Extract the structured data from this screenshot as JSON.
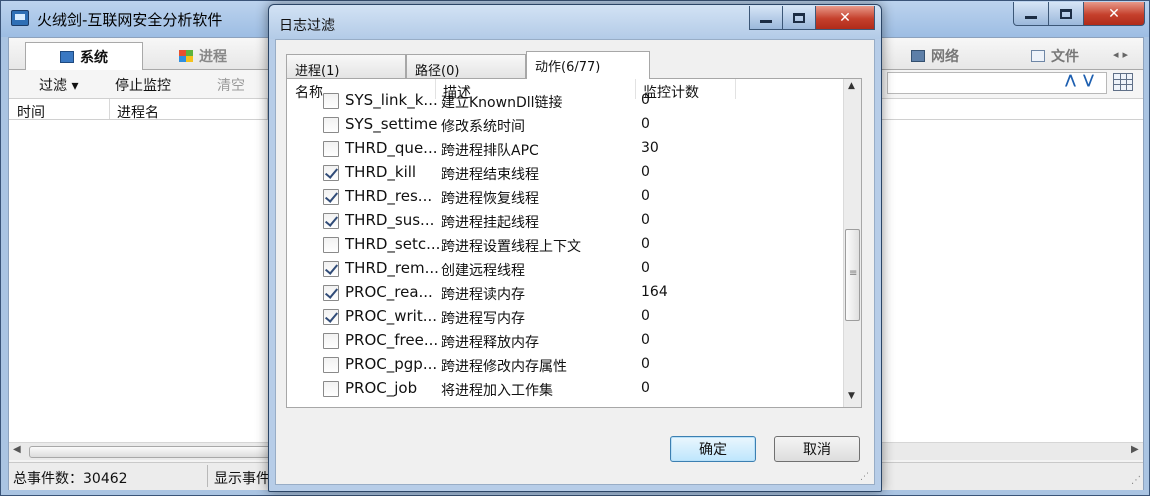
{
  "main_window": {
    "title": "火绒剑-互联网安全分析软件",
    "tabs": [
      {
        "label": "系统"
      },
      {
        "label": "进程"
      },
      {
        "label": "网络"
      },
      {
        "label": "文件"
      }
    ],
    "toolbar": {
      "filter": "过滤 ▾",
      "stop_monitor": "停止监控",
      "clear": "清空"
    },
    "columns": {
      "time": "时间",
      "process_name": "进程名"
    },
    "status": {
      "total_events": "总事件数：30462",
      "shown_events": "显示事件"
    }
  },
  "dialog": {
    "title": "日志过滤",
    "tabs": [
      {
        "label": "进程(1)"
      },
      {
        "label": "路径(0)"
      },
      {
        "label": "动作(6/77)"
      }
    ],
    "columns": {
      "name": "名称",
      "description": "描述",
      "count": "监控计数"
    },
    "rows": [
      {
        "name": "SYS_link_k...",
        "description": "建立KnownDll链接",
        "count": "0",
        "checked": false
      },
      {
        "name": "SYS_settime",
        "description": "修改系统时间",
        "count": "0",
        "checked": false
      },
      {
        "name": "THRD_que...",
        "description": "跨进程排队APC",
        "count": "30",
        "checked": false
      },
      {
        "name": "THRD_kill",
        "description": "跨进程结束线程",
        "count": "0",
        "checked": true
      },
      {
        "name": "THRD_res...",
        "description": "跨进程恢复线程",
        "count": "0",
        "checked": true
      },
      {
        "name": "THRD_sus...",
        "description": "跨进程挂起线程",
        "count": "0",
        "checked": true
      },
      {
        "name": "THRD_setc...",
        "description": "跨进程设置线程上下文",
        "count": "0",
        "checked": false
      },
      {
        "name": "THRD_rem...",
        "description": "创建远程线程",
        "count": "0",
        "checked": true
      },
      {
        "name": "PROC_rea...",
        "description": "跨进程读内存",
        "count": "164",
        "checked": true
      },
      {
        "name": "PROC_writ...",
        "description": "跨进程写内存",
        "count": "0",
        "checked": true
      },
      {
        "name": "PROC_free...",
        "description": "跨进程释放内存",
        "count": "0",
        "checked": false
      },
      {
        "name": "PROC_pgp...",
        "description": "跨进程修改内存属性",
        "count": "0",
        "checked": false
      },
      {
        "name": "PROC_job",
        "description": "将进程加入工作集",
        "count": "0",
        "checked": false
      }
    ],
    "buttons": {
      "ok": "确定",
      "cancel": "取消"
    }
  }
}
